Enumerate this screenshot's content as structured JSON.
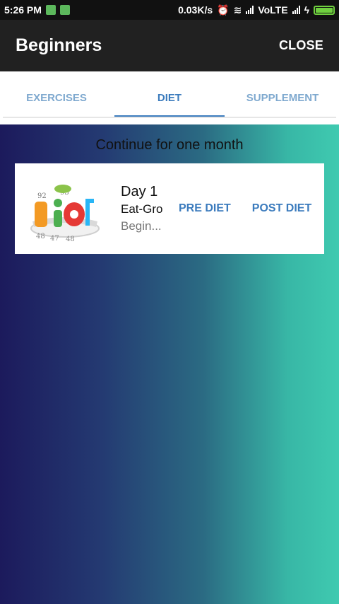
{
  "status_bar": {
    "time": "5:26 PM",
    "speed": "0.03K/s",
    "network": "VoLTE",
    "icons": [
      "notification-icon",
      "android-icon",
      "alarm-icon",
      "wifi-icon",
      "signal-icon",
      "signal-icon",
      "charging-icon",
      "battery-icon"
    ]
  },
  "app_bar": {
    "title": "Beginners",
    "close_label": "CLOSE"
  },
  "tabs": [
    {
      "label": "EXERCISES",
      "active": false
    },
    {
      "label": "DIET",
      "active": true
    },
    {
      "label": "SUPPLEMENT",
      "active": false
    }
  ],
  "main": {
    "heading": "Continue for one month",
    "card": {
      "image": "diet-measuring-tape-image",
      "day": "Day 1",
      "subtitle": "Eat-Gro",
      "desc": "Begin...",
      "pre_diet_label": "PRE DIET",
      "post_diet_label": "POST DIET"
    }
  },
  "colors": {
    "app_bar": "#212121",
    "accent": "#3b7bbd",
    "tab_inactive": "#7fa9cf",
    "gradient_start": "#1c1a5c",
    "gradient_end": "#3fcab0"
  }
}
